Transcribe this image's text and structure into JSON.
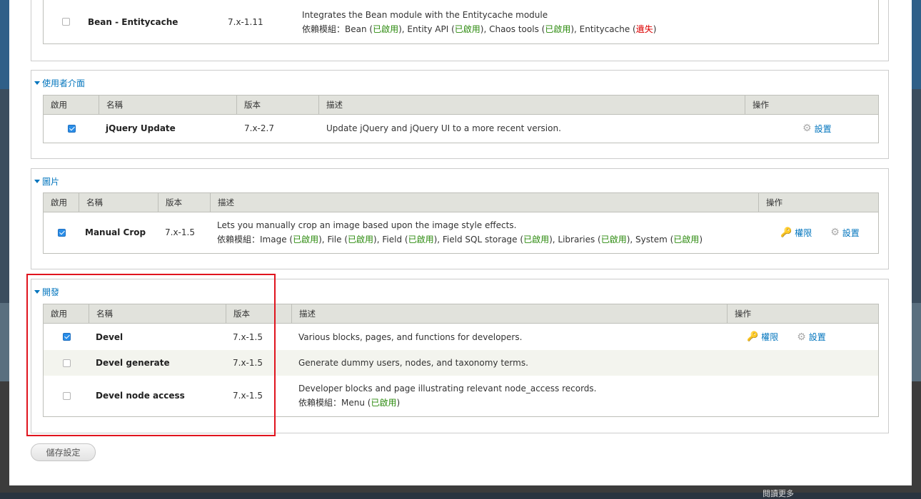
{
  "colors": {
    "link": "#0074bd",
    "enabled": "#2b8a0d",
    "missing": "#dd0000",
    "highlight": "#e0141e"
  },
  "headers": {
    "enable": "啟用",
    "name": "名稱",
    "version": "版本",
    "description": "描述",
    "operations": "操作"
  },
  "labels": {
    "deps_prefix": "依賴模組：",
    "enabled": "已啟用",
    "missing": "遺失",
    "permissions": "權限",
    "configure": "設置"
  },
  "top_fieldset": {
    "module": {
      "name": "Bean - Entitycache",
      "version": "7.x-1.11",
      "description": "Integrates the Bean module with the Entitycache module",
      "deps": [
        "Bean",
        "Entity API",
        "Chaos tools",
        "Entitycache"
      ]
    }
  },
  "ui_fieldset": {
    "title": "使用者介面",
    "module": {
      "name": "jQuery Update",
      "version": "7.x-2.7",
      "description": "Update jQuery and jQuery UI to a more recent version.",
      "enabled": true
    }
  },
  "image_fieldset": {
    "title": "圖片",
    "module": {
      "name": "Manual Crop",
      "version": "7.x-1.5",
      "description": "Lets you manually crop an image based upon the image style effects.",
      "deps": [
        "Image",
        "File",
        "Field",
        "Field SQL storage",
        "Libraries",
        "System"
      ],
      "enabled": true
    }
  },
  "dev_fieldset": {
    "title": "開發",
    "modules": [
      {
        "name": "Devel",
        "version": "7.x-1.5",
        "description": "Various blocks, pages, and functions for developers.",
        "enabled": true
      },
      {
        "name": "Devel generate",
        "version": "7.x-1.5",
        "description": "Generate dummy users, nodes, and taxonomy terms.",
        "enabled": false
      },
      {
        "name": "Devel node access",
        "version": "7.x-1.5",
        "description": "Developer blocks and page illustrating relevant node_access records.",
        "deps": [
          "Menu"
        ],
        "enabled": false
      }
    ]
  },
  "save_button": "儲存設定",
  "footer_text": "閱讀更多"
}
